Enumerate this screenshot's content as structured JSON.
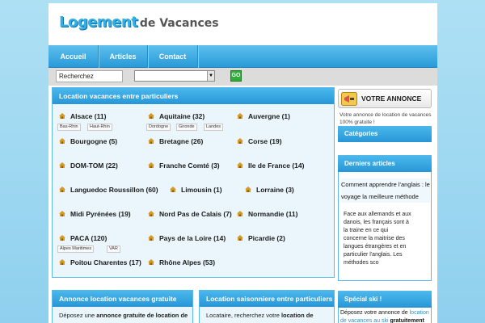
{
  "logo": {
    "part1": "Logement",
    "part2": "de Vacances"
  },
  "nav": [
    {
      "label": "Accueil"
    },
    {
      "label": "Articles"
    },
    {
      "label": "Contact"
    }
  ],
  "search": {
    "placeholder": "Recherchez",
    "value": "Recherchez",
    "go_label": "GO"
  },
  "main_panel": {
    "title": "Location vacances entre particuliers",
    "regions": [
      {
        "label": "Alsace (11)",
        "tags": [
          "Bas-Rhin",
          "Haut-Rhin"
        ]
      },
      {
        "label": "Aquitaine (32)",
        "tags": [
          "Dordogne",
          "Gironde",
          "Landes"
        ]
      },
      {
        "label": "Auvergne (1)",
        "tags": []
      },
      {
        "label": "Bourgogne (5)",
        "tags": []
      },
      {
        "label": "Bretagne (26)",
        "tags": []
      },
      {
        "label": "Corse (19)",
        "tags": []
      },
      {
        "label": "DOM-TOM (22)",
        "tags": []
      },
      {
        "label": "Franche Comté (3)",
        "tags": []
      },
      {
        "label": "Ile de France (14)",
        "tags": []
      },
      {
        "label": "Languedoc Roussillon (60)",
        "tags": []
      },
      {
        "label": "Limousin (1)",
        "tags": []
      },
      {
        "label": "Lorraine (3)",
        "tags": []
      },
      {
        "label": "Midi Pyrénées (19)",
        "tags": []
      },
      {
        "label": "Nord Pas de Calais (7)",
        "tags": []
      },
      {
        "label": "Normandie (11)",
        "tags": []
      },
      {
        "label": "PACA (120)",
        "tags": [
          "Alpes Maritimes",
          "VAR"
        ]
      },
      {
        "label": "Pays de la Loire (14)",
        "tags": []
      },
      {
        "label": "Picardie (2)",
        "tags": []
      },
      {
        "label": "Poitou Charentes (17)",
        "tags": []
      },
      {
        "label": "Rhône Alpes (53)",
        "tags": []
      }
    ]
  },
  "bottom_left": {
    "title": "Annonce location vacances gratuite",
    "text_pre": "Déposez une ",
    "text_bold": "annonce gratuite de location de"
  },
  "bottom_mid": {
    "title": "Location saisonniere entre particuliers",
    "text_pre": "Locataire, recherchez votre ",
    "text_bold": "location de"
  },
  "sidebar": {
    "annonce_label": "VOTRE ANNONCE",
    "annonce_note": "Votre annonce de location de vacances 100% gratuite !",
    "categories_title": "Catégories",
    "derniers_title": "Derniers articles",
    "article_link": "Comment apprendre l'anglais : le voyage la meilleure méthode",
    "article_excerpt": "Face aux allemands et aux danois, les français sont à la traine en ce qui concerne la maitrise des langues étrangères et en particulier l'anglais. Les méthodes sco",
    "special_title": "Spécial ski !",
    "special_pre": "Déposez votre annonce de ",
    "special_hl": "location de vacances au ski",
    "special_post": " gratuitement"
  },
  "colors": {
    "accent": "#2a9ad8",
    "background": "#aee0f4",
    "go": "#2fae3a"
  },
  "icons": {
    "region": "house-icon",
    "annonce": "megaphone-icon",
    "select": "dropdown-arrow-icon"
  }
}
